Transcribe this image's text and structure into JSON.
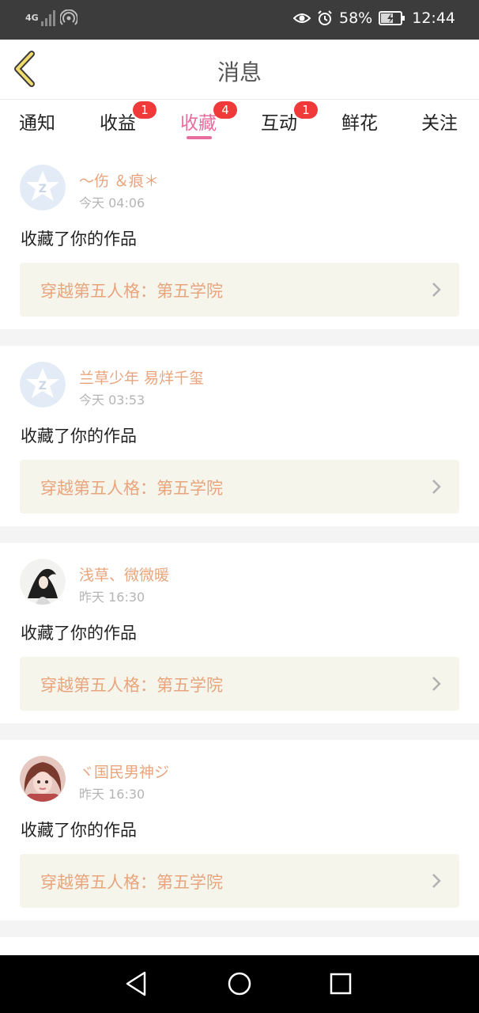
{
  "status_bar": {
    "network": "4G",
    "battery": "58%",
    "time": "12:44",
    "icons": [
      "signal-icon",
      "wifi-hotspot-icon",
      "eye-icon",
      "alarm-icon",
      "battery-charging-icon"
    ]
  },
  "header": {
    "title": "消息",
    "back_icon": "chevron-left-icon"
  },
  "tabs": [
    {
      "label": "通知",
      "badge": ""
    },
    {
      "label": "收益",
      "badge": "1"
    },
    {
      "label": "收藏",
      "badge": "4",
      "active": true
    },
    {
      "label": "互动",
      "badge": "1"
    },
    {
      "label": "鲜花",
      "badge": ""
    },
    {
      "label": "关注",
      "badge": ""
    }
  ],
  "notifications": [
    {
      "username": "～伤 ＆痕＊",
      "time": "今天 04:06",
      "message": "收藏了你的作品",
      "work": "穿越第五人格：第五学院",
      "avatar": "default-avatar"
    },
    {
      "username": "兰草少年 易烊千玺",
      "time": "今天 03:53",
      "message": "收藏了你的作品",
      "work": "穿越第五人格：第五学院",
      "avatar": "default-avatar"
    },
    {
      "username": "浅草、微微暖",
      "time": "昨天 16:30",
      "message": "收藏了你的作品",
      "work": "穿越第五人格：第五学院",
      "avatar": "photo-avatar-ink"
    },
    {
      "username": "ヾ国民男神ジ",
      "time": "昨天 16:30",
      "message": "收藏了你的作品",
      "work": "穿越第五人格：第五学院",
      "avatar": "photo-avatar-girl"
    }
  ],
  "colors": {
    "accent": "#e86c9d",
    "username": "#e8a57d",
    "badge": "#f03a3a",
    "work_box_bg": "#f5f5ec"
  }
}
